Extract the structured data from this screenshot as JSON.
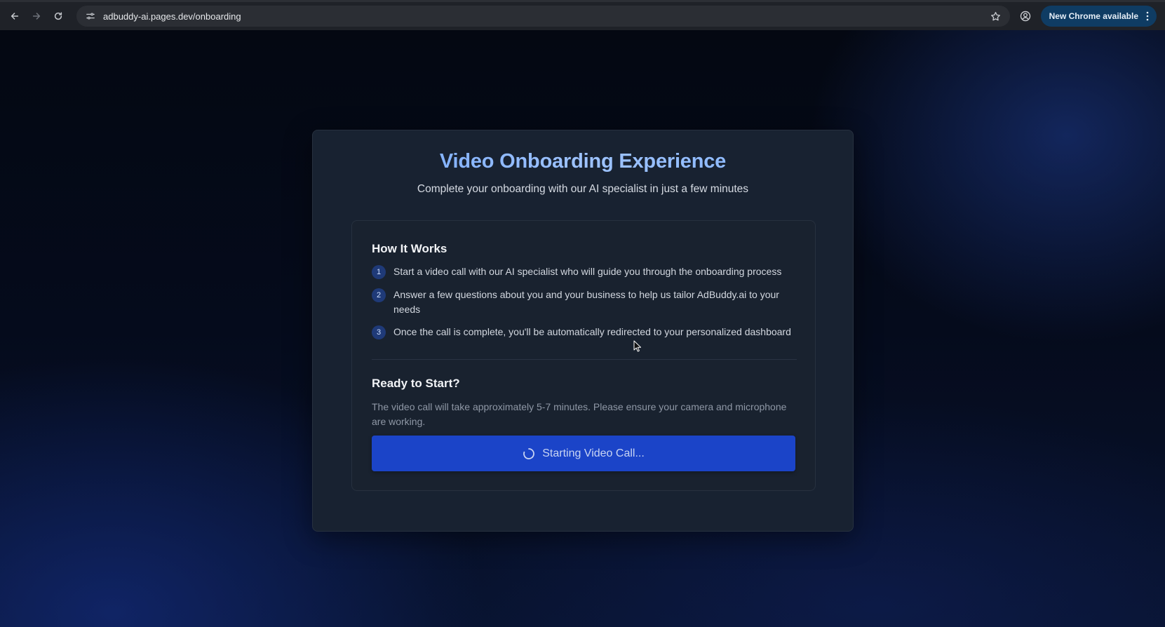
{
  "browser": {
    "url": "adbuddy-ai.pages.dev/onboarding",
    "update_label": "New Chrome available",
    "icons": {
      "back": "back-arrow-icon",
      "forward": "forward-arrow-icon",
      "reload": "reload-icon",
      "site_info": "site-info-icon",
      "bookmark": "star-icon",
      "profile": "profile-icon",
      "menu": "more-vert-icon"
    }
  },
  "card": {
    "title": "Video Onboarding Experience",
    "subtitle": "Complete your onboarding with our AI specialist in just a few minutes"
  },
  "how_it_works": {
    "heading": "How It Works",
    "steps": [
      {
        "number": "1",
        "text": "Start a video call with our AI specialist who will guide you through the onboarding process"
      },
      {
        "number": "2",
        "text": "Answer a few questions about you and your business to help us tailor AdBuddy.ai to your needs"
      },
      {
        "number": "3",
        "text": "Once the call is complete, you'll be automatically redirected to your personalized dashboard"
      }
    ]
  },
  "ready": {
    "heading": "Ready to Start?",
    "description": "The video call will take approximately 5-7 minutes. Please ensure your camera and microphone are working.",
    "button_label": "Starting Video Call...",
    "button_icon": "spinner-icon"
  },
  "colors": {
    "title_accent": "#7fb0ff",
    "button_bg": "#1b44c8",
    "step_badge_bg": "#1f3a78",
    "card_bg": "#182231",
    "page_bg": "#050a17"
  }
}
